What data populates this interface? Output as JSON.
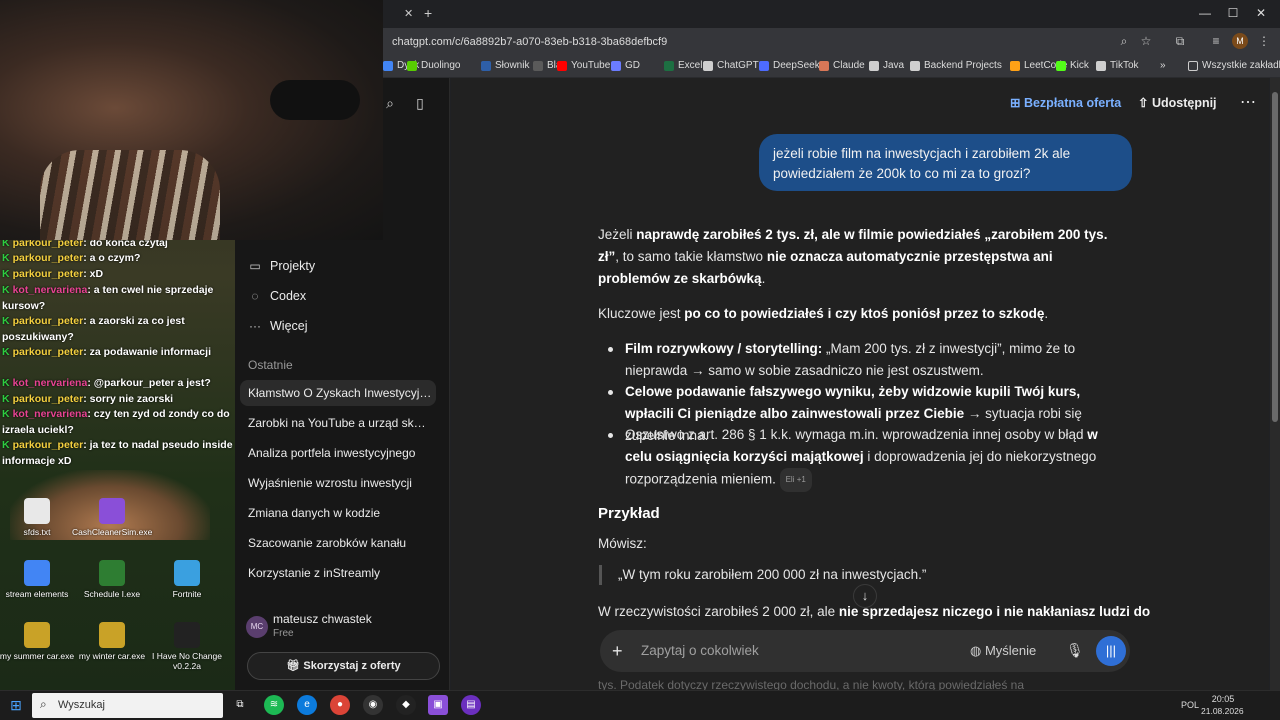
{
  "browser": {
    "url": "chatgpt.com/c/6a8892b7-a070-83eb-b318-3ba68defbcf9",
    "bookmarks": [
      {
        "label": "Dysk",
        "color": "#4285f4"
      },
      {
        "label": "Duolingo",
        "color": "#58cc02"
      },
      {
        "label": "Słownik",
        "color": "#2e5fa8"
      },
      {
        "label": "Bla",
        "color": "#5a5a5a"
      },
      {
        "label": "YouTube",
        "color": "#ff0000"
      },
      {
        "label": "GD",
        "color": "#6b7cff"
      },
      {
        "label": "Excel",
        "color": "#1d6f42"
      },
      {
        "label": "ChatGPT",
        "color": "#cfcfcf"
      },
      {
        "label": "DeepSeek",
        "color": "#4d6bfe"
      },
      {
        "label": "Claude",
        "color": "#d97757"
      },
      {
        "label": "Java",
        "color": "#cfcfcf"
      },
      {
        "label": "Backend Projects",
        "color": "#cfcfcf"
      },
      {
        "label": "LeetCode",
        "color": "#ffa116"
      },
      {
        "label": "Kick",
        "color": "#53fc18"
      },
      {
        "label": "TikTok",
        "color": "#cfcfcf"
      }
    ],
    "all_bookmarks": "Wszystkie zakładki"
  },
  "stream": {
    "chat": [
      {
        "user": "parkour_peter",
        "msg": "do konca czytaj",
        "kind": "p"
      },
      {
        "user": "parkour_peter",
        "msg": "a o czym?",
        "kind": "p"
      },
      {
        "user": "parkour_peter",
        "msg": "xD",
        "kind": "p"
      },
      {
        "user": "kot_nervariena",
        "msg": "a ten cwel nie sprzedaje kursow?",
        "kind": "k"
      },
      {
        "user": "parkour_peter",
        "msg": "a zaorski za co jest poszukiwany?",
        "kind": "p"
      },
      {
        "user": "parkour_peter",
        "msg": "za podawanie informacji",
        "kind": "p"
      },
      {
        "user": "kot_nervariena",
        "msg": "@parkour_peter a jest?",
        "kind": "k"
      },
      {
        "user": "parkour_peter",
        "msg": "sorry nie zaorski",
        "kind": "p"
      },
      {
        "user": "kot_nervariena",
        "msg": "czy ten zyd od zondy co do izraela uciekl?",
        "kind": "k"
      },
      {
        "user": "parkour_peter",
        "msg": "ja tez to nadal pseudo inside informacje xD",
        "kind": "p"
      }
    ],
    "desktop_icons": [
      {
        "label": "sfds.txt",
        "color": "#e8e8e8"
      },
      {
        "label": "CashCleanerSim.exe",
        "color": "#8a4fd8"
      },
      {
        "label": "stream elements",
        "color": "#4285f4"
      },
      {
        "label": "Schedule I.exe",
        "color": "#2e7d32"
      },
      {
        "label": "Fortnite",
        "color": "#3aa0e0"
      },
      {
        "label": "my summer car.exe",
        "color": "#c9a227"
      },
      {
        "label": "my winter car.exe",
        "color": "#c9a227"
      },
      {
        "label": "I Have No Change v0.2.2a",
        "color": "#222222"
      }
    ]
  },
  "sidebar": {
    "nav": [
      {
        "label": "Projekty",
        "icon": "folder-icon"
      },
      {
        "label": "Codex",
        "icon": "codex-icon"
      },
      {
        "label": "Więcej",
        "icon": "more-icon"
      }
    ],
    "recent_label": "Ostatnie",
    "chats": [
      "Kłamstwo O Zyskach Inwestycyjnych",
      "Zarobki na YouTube a urząd skarbowy",
      "Analiza portfela inwestycyjnego",
      "Wyjaśnienie wzrostu inwestycji",
      "Zmiana danych w kodzie",
      "Szacowanie zarobków kanału",
      "Korzystanie z inStreamly"
    ],
    "user": {
      "initials": "MC",
      "name": "mateusz chwastek",
      "plan": "Free"
    },
    "offer_button": "Skorzystaj z oferty"
  },
  "header": {
    "offer": "Bezpłatna oferta",
    "share": "Udostępnij"
  },
  "conversation": {
    "user_msg": "jeżeli robie film na inwestycjach i zarobiłem 2k ale powiedziałem że 200k to co mi za to grozi?",
    "p1_a": "Jeżeli ",
    "p1_b": "naprawdę zarobiłeś 2 tys. zł, ale w filmie powiedziałeś „zarobiłem 200 tys. zł”",
    "p1_c": ", to samo takie kłamstwo ",
    "p1_d": "nie oznacza automatycznie przestępstwa ani problemów ze skarbówką",
    "p1_e": ".",
    "p2_a": "Kluczowe jest ",
    "p2_b": "po co to powiedziałeś i czy ktoś poniósł przez to szkodę",
    "p2_c": ".",
    "b1_a": "Film rozrywkowy / storytelling:",
    "b1_b": " „Mam 200 tys. zł z inwestycji”, mimo że to nieprawda → samo w sobie zasadniczo nie jest oszustwem.",
    "b2_a": "Celowe podawanie fałszywego wyniku, żeby widzowie kupili Twój kurs, wpłacili Ci pieniądze albo zainwestowali przez Ciebie",
    "b2_b": " → sytuacja robi się zupełnie inna.",
    "b3_a": "Oszustwo z art. 286 § 1 k.k. wymaga m.in. wprowadzenia innej osoby w błąd ",
    "b3_b": "w celu osiągnięcia korzyści majątkowej",
    "b3_c": " i doprowadzenia jej do niekorzystnego rozporządzenia mieniem.",
    "cite": "Eli +1",
    "heading": "Przykład",
    "p3": "Mówisz:",
    "quote": "„W tym roku zarobiłem 200 000 zł na inwestycjach.”",
    "p4_a": "W rzeczywistości zarobiłeś 2 000 zł, ale ",
    "p4_b": "nie sprzedajesz niczego i nie nakłaniasz ludzi do",
    "faded": "tys. Podatek dotyczy rzeczywistego dochodu, a nie kwoty, którą powiedziałeś na"
  },
  "composer": {
    "placeholder": "Zapytaj o cokolwiek",
    "thinking": "Myślenie"
  },
  "taskbar": {
    "search": "Wyszukaj",
    "lang": "POL",
    "time": "20:05",
    "date": "21.08.2026"
  }
}
